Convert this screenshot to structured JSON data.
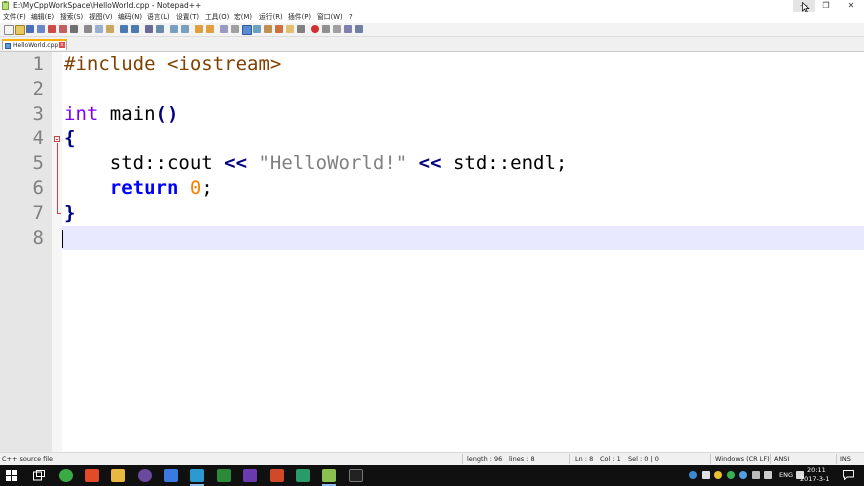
{
  "window": {
    "title": "E:\\MyCppWorkSpace\\HelloWorld.cpp - Notepad++",
    "minimize_glyph": "—",
    "maximize_glyph": "❐",
    "close_glyph": "✕"
  },
  "menu": {
    "items": [
      "文件(F)",
      "编辑(E)",
      "搜索(S)",
      "视图(V)",
      "编码(N)",
      "语言(L)",
      "设置(T)",
      "工具(O)",
      "宏(M)",
      "运行(R)",
      "插件(P)",
      "窗口(W)",
      "?"
    ]
  },
  "tabs": [
    {
      "label": "HelloWorld.cpp",
      "close_glyph": "x"
    }
  ],
  "editor": {
    "line_numbers": [
      "1",
      "2",
      "3",
      "4",
      "5",
      "6",
      "7",
      "8"
    ],
    "lines": {
      "l1_pre": "#include <iostream>",
      "l3_type": "int",
      "l3_rest": " main",
      "l3_parens": "()",
      "l4": "{",
      "l5_indent": "    ",
      "l5_std": "std::cout ",
      "l5_op1": "<<",
      "l5_str": " \"HelloWorld!\" ",
      "l5_op2": "<<",
      "l5_end": " std::endl;",
      "l6_indent": "    ",
      "l6_kw": "return",
      "l6_num": " 0",
      "l6_semi": ";",
      "l7": "}"
    }
  },
  "status": {
    "file_type": "C++ source file",
    "length": "length : 96",
    "lines": "lines : 8",
    "ln": "Ln : 8",
    "col": "Col : 1",
    "sel": "Sel : 0 | 0",
    "eol": "Windows (CR LF)",
    "encoding": "ANSI",
    "mode": "INS"
  },
  "taskbar": {
    "language": "ENG",
    "time": "20:11",
    "date": "2017-3-1"
  },
  "colors": {
    "accent_tab": "#ffb000",
    "preprocessor": "#804000",
    "type_keyword": "#8000ff",
    "statement_keyword": "#0000ff",
    "operator": "#000080",
    "string": "#808080",
    "number": "#ff8000",
    "current_line": "#e8e8ff"
  }
}
